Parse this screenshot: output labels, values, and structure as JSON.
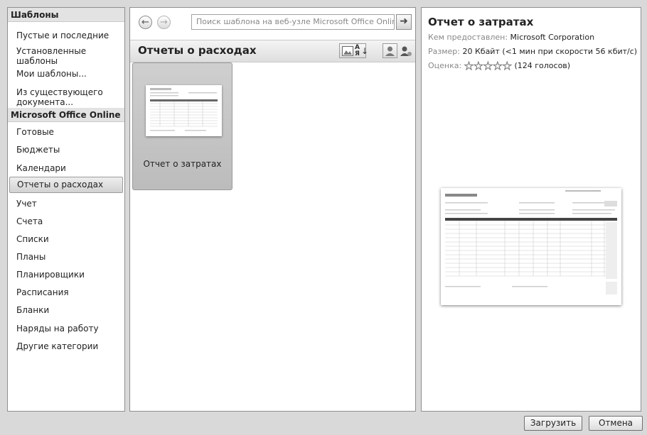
{
  "sidebar": {
    "heading": "Шаблоны",
    "items_top": [
      {
        "label": "Пустые и последние"
      },
      {
        "label": "Установленные шаблоны"
      },
      {
        "label": "Мои шаблоны..."
      },
      {
        "label": "Из существующего документа..."
      }
    ],
    "online_heading": "Microsoft Office Online",
    "online_items": [
      {
        "label": "Готовые"
      },
      {
        "label": "Бюджеты"
      },
      {
        "label": "Календари"
      },
      {
        "label": "Отчеты о расходах",
        "selected": true
      },
      {
        "label": "Учет"
      },
      {
        "label": "Счета"
      },
      {
        "label": "Списки"
      },
      {
        "label": "Планы"
      },
      {
        "label": "Планировщики"
      },
      {
        "label": "Расписания"
      },
      {
        "label": "Бланки"
      },
      {
        "label": "Наряды на работу"
      },
      {
        "label": "Другие категории"
      }
    ]
  },
  "search": {
    "placeholder": "Поиск шаблона на веб-узле Microsoft Office Online",
    "back_icon": "back-arrow-icon",
    "forward_icon": "forward-arrow-icon",
    "go_icon": "go-arrow-icon"
  },
  "category": {
    "title": "Отчеты о расходах",
    "tools": [
      "large-thumbnails-icon",
      "sort-az-icon",
      "user-icon",
      "user-filter-icon"
    ]
  },
  "templates": [
    {
      "label": "Отчет о затратах"
    }
  ],
  "preview": {
    "title": "Отчет о затратах",
    "provided_by_label": "Кем предоставлен:",
    "provided_by_value": "Microsoft Corporation",
    "size_label": "Размер:",
    "size_value": "20 Кбайт (<1 мин при скорости 56 кбит/с)",
    "rating_label": "Оценка:",
    "rating_value": 0,
    "rating_max": 5,
    "votes": "(124 голосов)"
  },
  "buttons": {
    "download": "Загрузить",
    "cancel": "Отмена"
  },
  "colors": {
    "dialog_bg": "#d9d9d9",
    "selected_bg": "#dcdcdc",
    "label_gray": "#888888"
  }
}
